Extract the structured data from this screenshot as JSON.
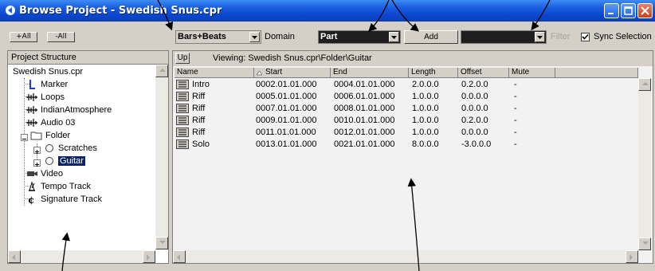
{
  "window": {
    "title": "Browse Project - Swedish Snus.cpr"
  },
  "toolbar": {
    "expand_all": "+All",
    "collapse_all": "-All",
    "format_value": "Bars+Beats",
    "domain_label": "Domain",
    "type_value": "Part",
    "add_label": "Add",
    "filter_value": "",
    "filter_label": "Filter",
    "sync_label": "Sync Selection",
    "sync_checked": true
  },
  "left_panel": {
    "header": "Project Structure",
    "tree": [
      {
        "label": "Swedish Snus.cpr",
        "icon": "project-icon"
      },
      {
        "label": "Marker",
        "icon": "marker-icon"
      },
      {
        "label": "Loops",
        "icon": "audio-track-icon"
      },
      {
        "label": "IndianAtmosphere",
        "icon": "audio-track-icon"
      },
      {
        "label": "Audio 03",
        "icon": "audio-track-icon"
      },
      {
        "label": "Folder",
        "icon": "folder-icon"
      },
      {
        "label": "Scratches",
        "icon": "circle-icon"
      },
      {
        "label": "Guitar",
        "icon": "circle-icon"
      },
      {
        "label": "Video",
        "icon": "video-icon"
      },
      {
        "label": "Tempo Track",
        "icon": "tempo-icon"
      },
      {
        "label": "Signature Track",
        "icon": "signature-icon"
      }
    ]
  },
  "right_panel": {
    "up_label": "Up",
    "viewing": "Viewing: Swedish Snus.cpr\\Folder\\Guitar",
    "columns": {
      "name": "Name",
      "start": "Start",
      "end": "End",
      "length": "Length",
      "offset": "Offset",
      "mute": "Mute"
    },
    "rows": [
      {
        "name": "Intro",
        "start": "0002.01.01.000",
        "end": "0004.01.01.000",
        "length": "2.0.0.0",
        "offset": "0.2.0.0",
        "mute": "-"
      },
      {
        "name": "Riff",
        "start": "0005.01.01.000",
        "end": "0006.01.01.000",
        "length": "1.0.0.0",
        "offset": "0.0.0.0",
        "mute": "-"
      },
      {
        "name": "Riff",
        "start": "0007.01.01.000",
        "end": "0008.01.01.000",
        "length": "1.0.0.0",
        "offset": "0.0.0.0",
        "mute": "-"
      },
      {
        "name": "Riff",
        "start": "0009.01.01.000",
        "end": "0010.01.01.000",
        "length": "1.0.0.0",
        "offset": "0.2.0.0",
        "mute": "-"
      },
      {
        "name": "Riff",
        "start": "0011.01.01.000",
        "end": "0012.01.01.000",
        "length": "1.0.0.0",
        "offset": "0.0.0.0",
        "mute": "-"
      },
      {
        "name": "Solo",
        "start": "0013.01.01.000",
        "end": "0021.01.01.000",
        "length": "8.0.0.0",
        "offset": "-3.0.0.0",
        "mute": "-"
      }
    ]
  },
  "colors": {
    "titlebar": "#0a46d0",
    "selection": "#0a246a",
    "face": "#d4d0c8"
  }
}
